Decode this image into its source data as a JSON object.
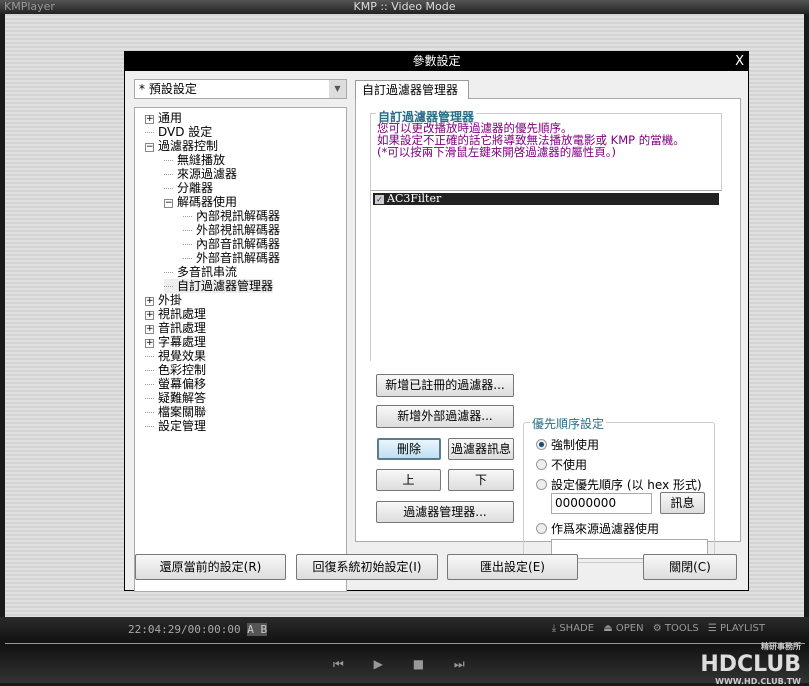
{
  "window": {
    "app_name": "KMPlayer",
    "title": "KMP :: Video Mode"
  },
  "dialog": {
    "title": "參數設定",
    "close": "X",
    "preset": "* 預設設定",
    "tree": [
      {
        "label": "通用",
        "exp": "+",
        "lvl": 0
      },
      {
        "label": "DVD 設定",
        "exp": "",
        "lvl": 0
      },
      {
        "label": "過濾器控制",
        "exp": "-",
        "lvl": 0
      },
      {
        "label": "無縫播放",
        "exp": "",
        "lvl": 1
      },
      {
        "label": "來源過濾器",
        "exp": "",
        "lvl": 1
      },
      {
        "label": "分離器",
        "exp": "",
        "lvl": 1
      },
      {
        "label": "解碼器使用",
        "exp": "-",
        "lvl": 1
      },
      {
        "label": "內部視訊解碼器",
        "exp": "",
        "lvl": 2
      },
      {
        "label": "外部視訊解碼器",
        "exp": "",
        "lvl": 2
      },
      {
        "label": "內部音訊解碼器",
        "exp": "",
        "lvl": 2
      },
      {
        "label": "外部音訊解碼器",
        "exp": "",
        "lvl": 2
      },
      {
        "label": "多音訊串流",
        "exp": "",
        "lvl": 1
      },
      {
        "label": "自訂過濾器管理器",
        "exp": "",
        "lvl": 1,
        "selected": true
      },
      {
        "label": "外掛",
        "exp": "+",
        "lvl": 0
      },
      {
        "label": "視訊處理",
        "exp": "+",
        "lvl": 0
      },
      {
        "label": "音訊處理",
        "exp": "+",
        "lvl": 0
      },
      {
        "label": "字幕處理",
        "exp": "+",
        "lvl": 0
      },
      {
        "label": "視覺效果",
        "exp": "",
        "lvl": 0
      },
      {
        "label": "色彩控制",
        "exp": "",
        "lvl": 0
      },
      {
        "label": "螢幕偏移",
        "exp": "",
        "lvl": 0
      },
      {
        "label": "疑難解答",
        "exp": "",
        "lvl": 0
      },
      {
        "label": "檔案關聯",
        "exp": "",
        "lvl": 0
      },
      {
        "label": "設定管理",
        "exp": "",
        "lvl": 0
      }
    ],
    "tab": "自訂過濾器管理器",
    "group_title": "自訂過濾器管理器",
    "desc": [
      "您可以更改播放時過濾器的優先順序。",
      "如果設定不正確的話它將導致無法播放電影或 KMP 的當機。",
      "(*可以按兩下滑鼠左鍵來開啓過濾器的屬性頁。)"
    ],
    "filters": [
      {
        "name": "AC3Filter",
        "checked": true
      }
    ],
    "buttons": {
      "add_registered": "新增已註冊的過濾器...",
      "add_external": "新增外部過濾器...",
      "delete": "刪除",
      "filter_info": "過濾器訊息",
      "up": "上",
      "down": "下",
      "filter_manager": "過濾器管理器..."
    },
    "priority": {
      "title": "優先順序設定",
      "force": "強制使用",
      "disable": "不使用",
      "set_priority": "設定優先順序 (以 hex 形式)",
      "hex_value": "00000000",
      "info": "訊息",
      "as_source": "作爲來源過濾器使用",
      "source_value": ""
    },
    "footer": {
      "restore": "還原當前的設定(R)",
      "reset": "回復系統初始設定(I)",
      "export": "匯出設定(E)",
      "close": "關閉(C)"
    }
  },
  "player": {
    "time": "22:04:29/00:00:00",
    "ab": "A B",
    "menu": [
      "⤓ SHADE",
      "⏏ OPEN",
      "⚙ TOOLS",
      "☰ PLAYLIST"
    ],
    "controls": [
      "⏮",
      "▶",
      "■",
      "⏭"
    ],
    "logo": "HDCLUB",
    "logo_sub": "精研事務所",
    "logo_url": "WWW.HD.CLUB.TW"
  }
}
